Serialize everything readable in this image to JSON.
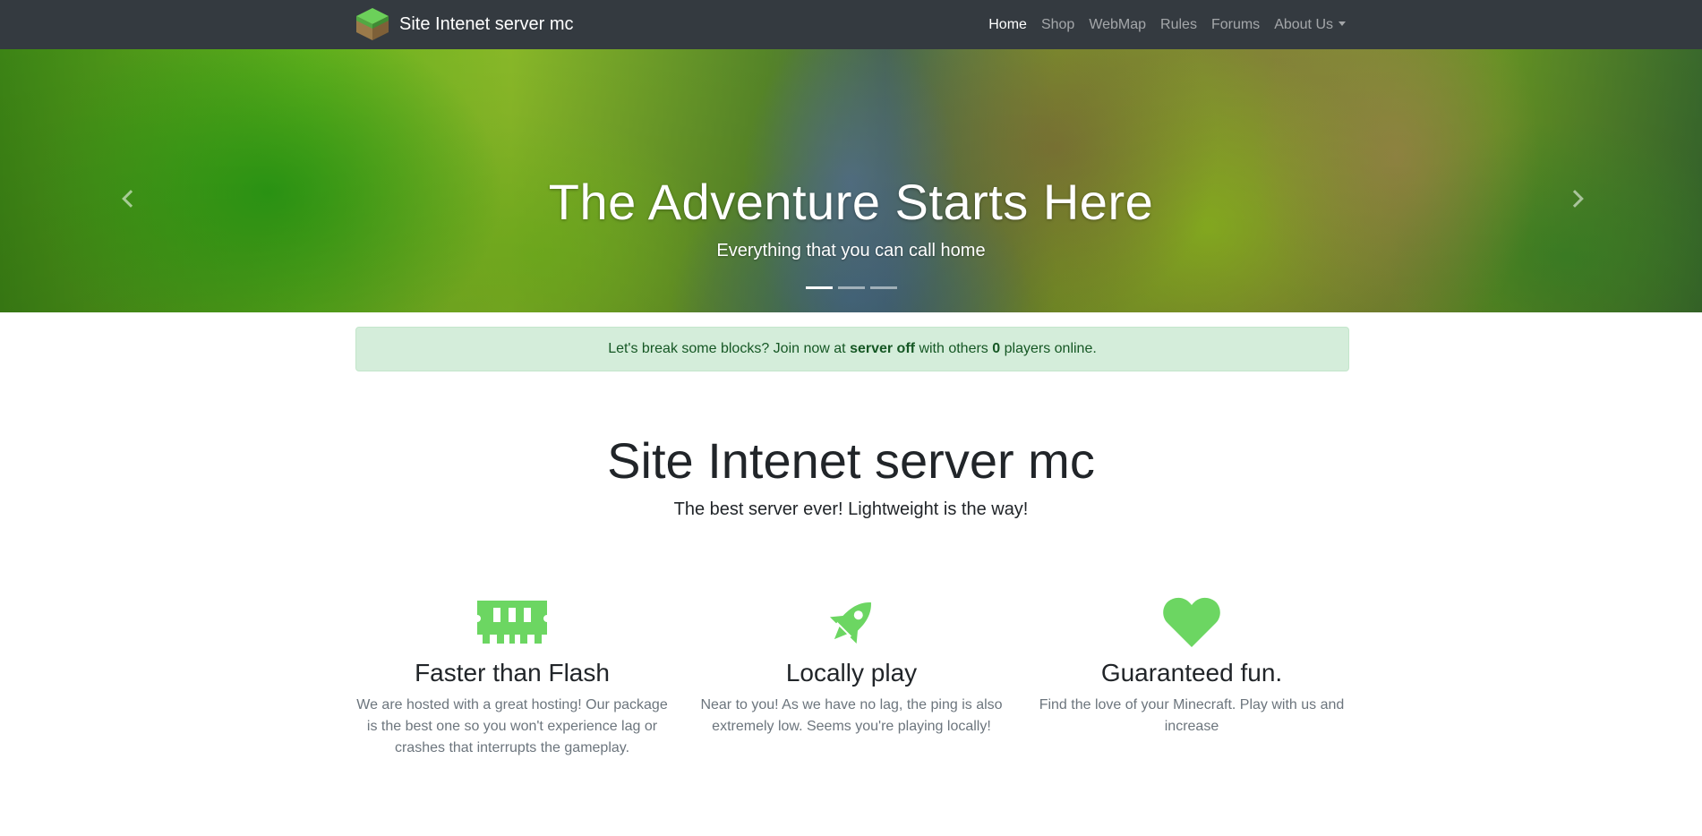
{
  "navbar": {
    "brand": "Site Intenet server mc",
    "links": [
      {
        "label": "Home"
      },
      {
        "label": "Shop"
      },
      {
        "label": "WebMap"
      },
      {
        "label": "Rules"
      },
      {
        "label": "Forums"
      },
      {
        "label": "About Us"
      }
    ],
    "active": "Home"
  },
  "carousel": {
    "title": "The Adventure Starts Here",
    "subtitle": "Everything that you can call home",
    "slide_count": 3,
    "active_slide": 1
  },
  "alert": {
    "prefix": "Let's break some blocks? Join now at",
    "server": "server off",
    "middle": "with others",
    "players": "0",
    "suffix": "players online."
  },
  "hero": {
    "title": "Site Intenet server mc",
    "lead": "The best server ever! Lightweight is the way!"
  },
  "features": [
    {
      "icon": "memory-icon",
      "title": "Faster than Flash",
      "text": "We are hosted with a great hosting! Our package is the best one so you won't experience lag or crashes that interrupts the gameplay."
    },
    {
      "icon": "rocket-icon",
      "title": "Locally play",
      "text": "Near to you! As we have no lag, the ping is also extremely low. Seems you're playing locally!"
    },
    {
      "icon": "heart-icon",
      "title": "Guaranteed fun.",
      "text": "Find the love of your Minecraft. Play with us and increase"
    }
  ],
  "colors": {
    "navbar_bg": "#343a40",
    "accent_green": "#6cd662",
    "alert_bg": "#d4edda",
    "alert_text": "#155724"
  }
}
